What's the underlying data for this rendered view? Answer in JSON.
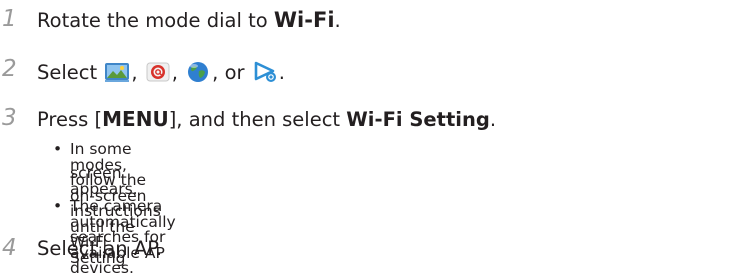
{
  "steps": [
    {
      "number": "1",
      "text_before": "Rotate the mode dial to ",
      "mode_label": "Wi-Fi",
      "text_after": "."
    },
    {
      "number": "2",
      "text_before": "Select ",
      "sep1": ", ",
      "sep2": ", ",
      "sep3": ", or ",
      "text_after": ".",
      "icons": [
        "photo-beam-icon",
        "email-icon",
        "globe-sns-icon",
        "allshare-play-icon"
      ]
    },
    {
      "number": "3",
      "text_before": "Press [",
      "key_label": "MENU",
      "text_mid": "], and then select ",
      "bold_label": "Wi-Fi Setting",
      "text_after": ".",
      "bullets": [
        {
          "mark": "•",
          "line1": "In some modes, follow the on-screen instructions until the Wi-Fi Setting",
          "line2": "screen appears."
        },
        {
          "mark": "•",
          "line1": "The camera automatically searches for available AP devices."
        }
      ]
    },
    {
      "number": "4",
      "text": "Select an AP."
    }
  ]
}
